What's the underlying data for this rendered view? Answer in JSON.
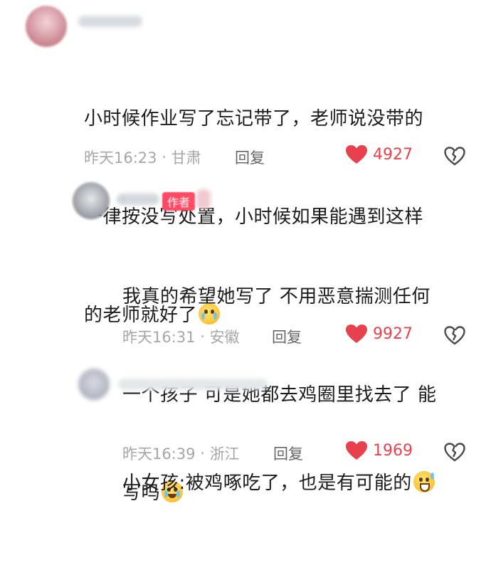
{
  "comments": [
    {
      "lines": [
        "小时候作业写了忘记带了，老师说没带的",
        "一律按没写处置，小时候如果能遇到这样",
        "的老师就好了"
      ],
      "emoji": "pleading-face-emoji",
      "time": "昨天16:23",
      "location": "甘肃",
      "reply_label": "回复",
      "likes": "4927"
    },
    {
      "badge": "作者",
      "lines": [
        "我真的希望她写了 不用恶意揣测任何",
        "一个孩子 可是她都去鸡圈里找去了 能",
        "写吗"
      ],
      "emoji": "crying-face-emoji",
      "time": "昨天16:31",
      "location": "安徽",
      "reply_label": "回复",
      "likes": "9927"
    },
    {
      "lines": [
        "小女孩:被鸡啄吃了，也是有可能的"
      ],
      "emoji": "grinning-sweat-emoji",
      "time": "昨天16:39",
      "location": "浙江",
      "reply_label": "回复",
      "likes": "1969"
    }
  ],
  "colors": {
    "like": "#e8414e",
    "meta": "#a6a6a6",
    "badge": "#ff4a64"
  },
  "icons": {
    "like": "heart-icon",
    "dislike": "broken-heart-icon"
  }
}
